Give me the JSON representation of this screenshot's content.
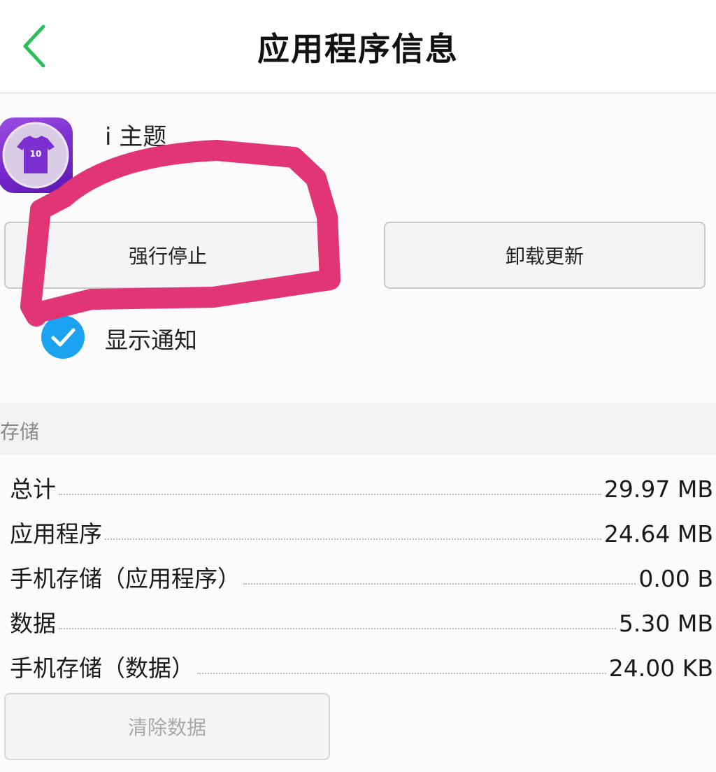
{
  "header": {
    "title": "应用程序信息",
    "back_icon": "chevron-left-icon",
    "accent": "#2dbf5a"
  },
  "app": {
    "name": "i 主题",
    "version": "",
    "icon": "tshirt-icon",
    "icon_badge": "10"
  },
  "actions": {
    "force_stop": "强行停止",
    "uninstall_updates": "卸载更新"
  },
  "notification": {
    "label": "显示通知",
    "checked": true,
    "color": "#1aa3f0"
  },
  "storage": {
    "section_title": "存储",
    "rows": [
      {
        "label": "总计",
        "value": "29.97 MB"
      },
      {
        "label": "应用程序",
        "value": "24.64 MB"
      },
      {
        "label": "手机存储（应用程序）",
        "value": "0.00 B"
      },
      {
        "label": "数据",
        "value": "5.30 MB"
      },
      {
        "label": "手机存储（数据）",
        "value": "24.00 KB"
      }
    ],
    "clear_button": "清除数据"
  },
  "annotation": {
    "color": "#e23576"
  }
}
